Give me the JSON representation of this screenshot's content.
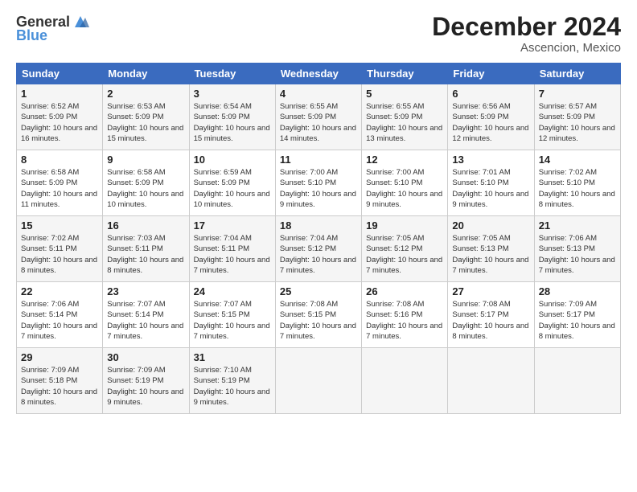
{
  "logo": {
    "general": "General",
    "blue": "Blue"
  },
  "header": {
    "month": "December 2024",
    "location": "Ascencion, Mexico"
  },
  "weekdays": [
    "Sunday",
    "Monday",
    "Tuesday",
    "Wednesday",
    "Thursday",
    "Friday",
    "Saturday"
  ],
  "weeks": [
    [
      {
        "day": "1",
        "sunrise": "6:52 AM",
        "sunset": "5:09 PM",
        "daylight": "10 hours and 16 minutes."
      },
      {
        "day": "2",
        "sunrise": "6:53 AM",
        "sunset": "5:09 PM",
        "daylight": "10 hours and 15 minutes."
      },
      {
        "day": "3",
        "sunrise": "6:54 AM",
        "sunset": "5:09 PM",
        "daylight": "10 hours and 15 minutes."
      },
      {
        "day": "4",
        "sunrise": "6:55 AM",
        "sunset": "5:09 PM",
        "daylight": "10 hours and 14 minutes."
      },
      {
        "day": "5",
        "sunrise": "6:55 AM",
        "sunset": "5:09 PM",
        "daylight": "10 hours and 13 minutes."
      },
      {
        "day": "6",
        "sunrise": "6:56 AM",
        "sunset": "5:09 PM",
        "daylight": "10 hours and 12 minutes."
      },
      {
        "day": "7",
        "sunrise": "6:57 AM",
        "sunset": "5:09 PM",
        "daylight": "10 hours and 12 minutes."
      }
    ],
    [
      {
        "day": "8",
        "sunrise": "6:58 AM",
        "sunset": "5:09 PM",
        "daylight": "10 hours and 11 minutes."
      },
      {
        "day": "9",
        "sunrise": "6:58 AM",
        "sunset": "5:09 PM",
        "daylight": "10 hours and 10 minutes."
      },
      {
        "day": "10",
        "sunrise": "6:59 AM",
        "sunset": "5:09 PM",
        "daylight": "10 hours and 10 minutes."
      },
      {
        "day": "11",
        "sunrise": "7:00 AM",
        "sunset": "5:10 PM",
        "daylight": "10 hours and 9 minutes."
      },
      {
        "day": "12",
        "sunrise": "7:00 AM",
        "sunset": "5:10 PM",
        "daylight": "10 hours and 9 minutes."
      },
      {
        "day": "13",
        "sunrise": "7:01 AM",
        "sunset": "5:10 PM",
        "daylight": "10 hours and 9 minutes."
      },
      {
        "day": "14",
        "sunrise": "7:02 AM",
        "sunset": "5:10 PM",
        "daylight": "10 hours and 8 minutes."
      }
    ],
    [
      {
        "day": "15",
        "sunrise": "7:02 AM",
        "sunset": "5:11 PM",
        "daylight": "10 hours and 8 minutes."
      },
      {
        "day": "16",
        "sunrise": "7:03 AM",
        "sunset": "5:11 PM",
        "daylight": "10 hours and 8 minutes."
      },
      {
        "day": "17",
        "sunrise": "7:04 AM",
        "sunset": "5:11 PM",
        "daylight": "10 hours and 7 minutes."
      },
      {
        "day": "18",
        "sunrise": "7:04 AM",
        "sunset": "5:12 PM",
        "daylight": "10 hours and 7 minutes."
      },
      {
        "day": "19",
        "sunrise": "7:05 AM",
        "sunset": "5:12 PM",
        "daylight": "10 hours and 7 minutes."
      },
      {
        "day": "20",
        "sunrise": "7:05 AM",
        "sunset": "5:13 PM",
        "daylight": "10 hours and 7 minutes."
      },
      {
        "day": "21",
        "sunrise": "7:06 AM",
        "sunset": "5:13 PM",
        "daylight": "10 hours and 7 minutes."
      }
    ],
    [
      {
        "day": "22",
        "sunrise": "7:06 AM",
        "sunset": "5:14 PM",
        "daylight": "10 hours and 7 minutes."
      },
      {
        "day": "23",
        "sunrise": "7:07 AM",
        "sunset": "5:14 PM",
        "daylight": "10 hours and 7 minutes."
      },
      {
        "day": "24",
        "sunrise": "7:07 AM",
        "sunset": "5:15 PM",
        "daylight": "10 hours and 7 minutes."
      },
      {
        "day": "25",
        "sunrise": "7:08 AM",
        "sunset": "5:15 PM",
        "daylight": "10 hours and 7 minutes."
      },
      {
        "day": "26",
        "sunrise": "7:08 AM",
        "sunset": "5:16 PM",
        "daylight": "10 hours and 7 minutes."
      },
      {
        "day": "27",
        "sunrise": "7:08 AM",
        "sunset": "5:17 PM",
        "daylight": "10 hours and 8 minutes."
      },
      {
        "day": "28",
        "sunrise": "7:09 AM",
        "sunset": "5:17 PM",
        "daylight": "10 hours and 8 minutes."
      }
    ],
    [
      {
        "day": "29",
        "sunrise": "7:09 AM",
        "sunset": "5:18 PM",
        "daylight": "10 hours and 8 minutes."
      },
      {
        "day": "30",
        "sunrise": "7:09 AM",
        "sunset": "5:19 PM",
        "daylight": "10 hours and 9 minutes."
      },
      {
        "day": "31",
        "sunrise": "7:10 AM",
        "sunset": "5:19 PM",
        "daylight": "10 hours and 9 minutes."
      },
      null,
      null,
      null,
      null
    ]
  ]
}
